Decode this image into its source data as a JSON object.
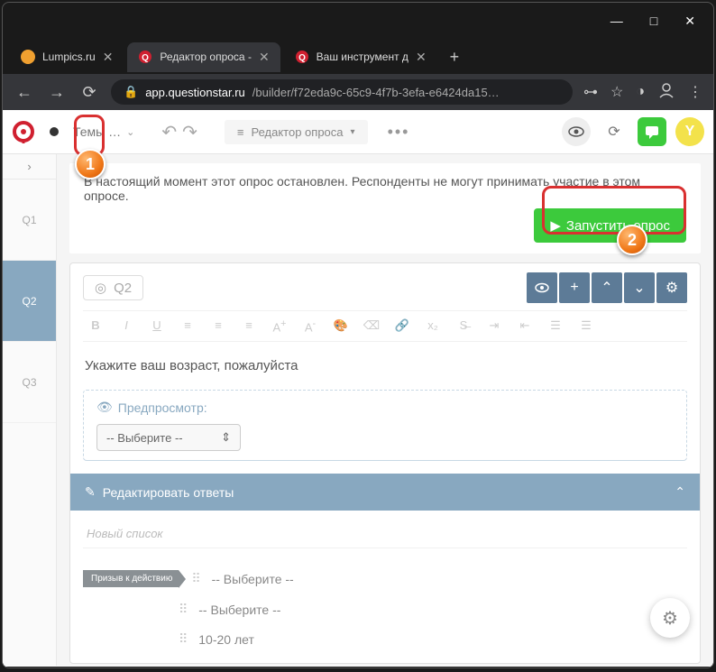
{
  "window": {
    "minimize": "—",
    "maximize": "□",
    "close": "✕"
  },
  "tabs": [
    {
      "title": "Lumpics.ru",
      "favicon_color": "#f0a030",
      "active": false
    },
    {
      "title": "Редактор опроса -",
      "favicon": "q-red",
      "active": true
    },
    {
      "title": "Ваш инструмент д",
      "favicon": "q-red",
      "active": false
    }
  ],
  "address": {
    "domain": "app.questionstar.ru",
    "path": "/builder/f72eda9c-65c9-4f7b-3efa-e6424da15…",
    "key_icon": "⊶"
  },
  "toolbar": {
    "themes_label": "Темы …",
    "editor_label": "Редактор опроса",
    "avatar_letter": "Y"
  },
  "sidebar": {
    "items": [
      "Q1",
      "Q2",
      "Q3"
    ],
    "active_index": 1
  },
  "notice": {
    "text": "В настоящий момент этот опрос остановлен. Респонденты не могут принимать участие в этом опросе.",
    "launch_button": "Запустить опрос"
  },
  "question": {
    "id": "Q2",
    "text": "Укажите ваш возраст, пожалуйста",
    "preview_label": "Предпросмотр:",
    "select_placeholder": "-- Выберите --",
    "edit_answers_label": "Редактировать ответы",
    "new_list_label": "Новый список",
    "cta_badge": "Призыв к действию",
    "answers": [
      "-- Выберите --",
      "-- Выберите --",
      "10-20 лет"
    ]
  },
  "overlays": {
    "balloon1": "1",
    "balloon2": "2"
  }
}
